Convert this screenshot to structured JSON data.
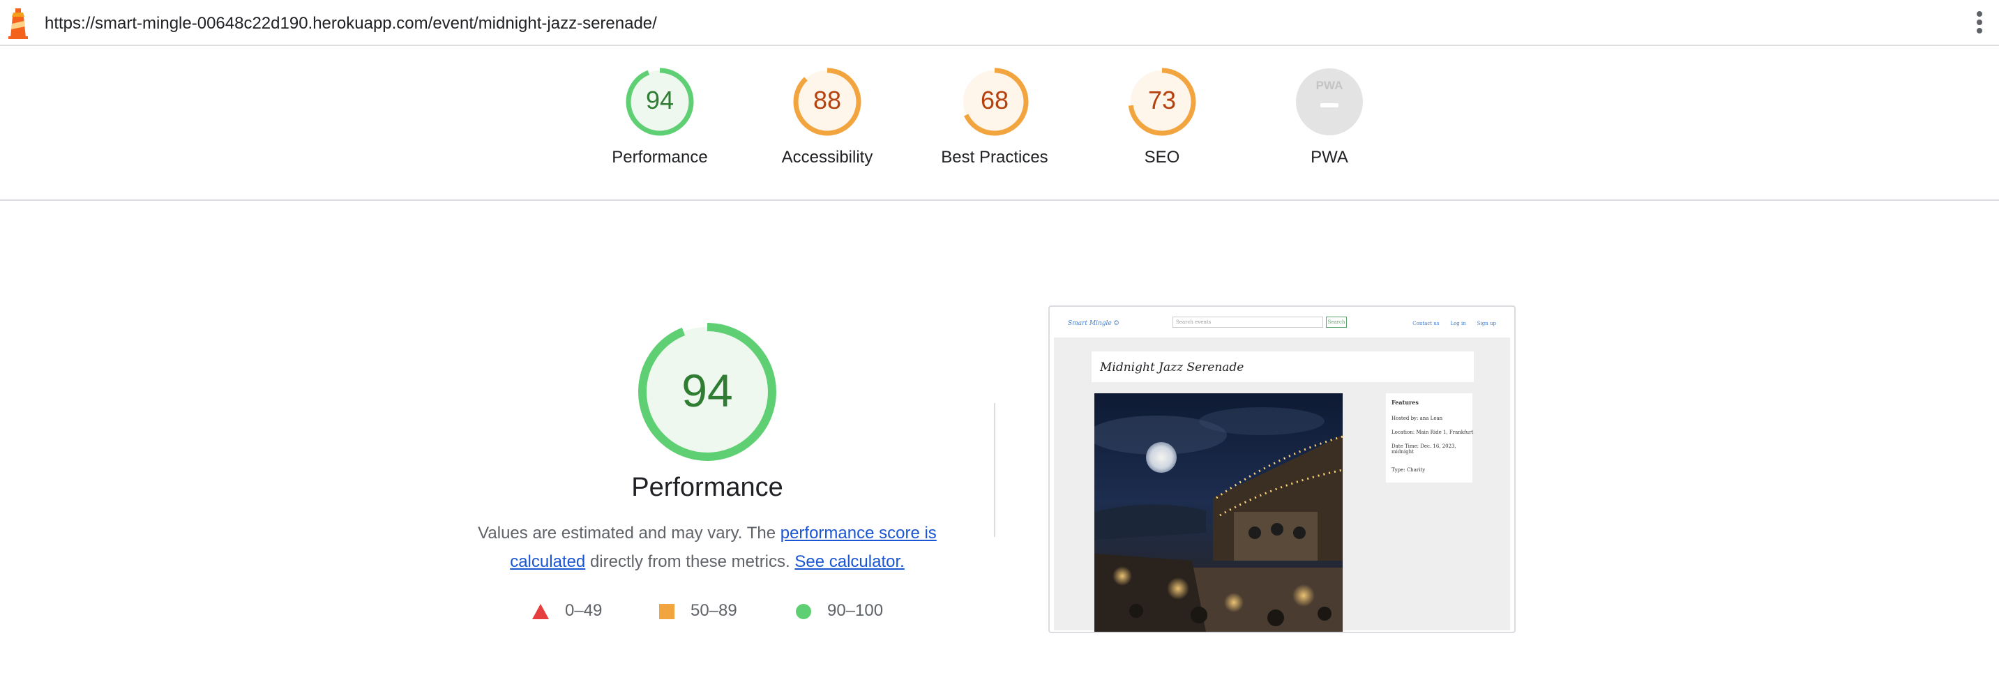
{
  "url": "https://smart-mingle-00648c22d190.herokuapp.com/event/midnight-jazz-serenade/",
  "colors": {
    "pass": "#0cce6b",
    "pass_ring": "#5fcf73",
    "pass_text": "#2e7d32",
    "pass_fill": "#eef8ee",
    "average": "#f2a43e",
    "average_text": "#b5410e",
    "average_fill": "#fef6ea",
    "fail": "#e63e3e",
    "na": "#e3e3e3",
    "link": "#1a55d4"
  },
  "categories": [
    {
      "label": "Performance",
      "score": "94",
      "value": 94,
      "rating": "pass"
    },
    {
      "label": "Accessibility",
      "score": "88",
      "value": 88,
      "rating": "average"
    },
    {
      "label": "Best Practices",
      "score": "68",
      "value": 68,
      "rating": "average"
    },
    {
      "label": "SEO",
      "score": "73",
      "value": 73,
      "rating": "average"
    },
    {
      "label": "PWA",
      "score": "",
      "value": null,
      "rating": "na",
      "badge": "PWA"
    }
  ],
  "detail": {
    "score": "94",
    "value": 94,
    "title": "Performance",
    "desc_prefix": "Values are estimated and may vary. The ",
    "desc_link1": "performance score is calculated",
    "desc_middle": " directly from these metrics. ",
    "desc_link2": "See calculator."
  },
  "legend": [
    {
      "range": "0–49",
      "icon": "triangle-icon",
      "color": "#e63e3e"
    },
    {
      "range": "50–89",
      "icon": "square-icon",
      "color": "#f2a43e"
    },
    {
      "range": "90–100",
      "icon": "circle-icon",
      "color": "#5fcf73"
    }
  ],
  "screenshot": {
    "brand": "Smart Mingle ☺",
    "search_placeholder": "Search events",
    "search_button": "Search",
    "nav_links": [
      "Contact us",
      "Log in",
      "Sign up"
    ],
    "event_title": "Midnight Jazz Serenade",
    "features_title": "Features",
    "features": [
      "Hosted by: ana Lean",
      "Location: Main Ride 1, Frankfurt",
      "Date Time: Dec. 16, 2023, midnight",
      "Type: Charity"
    ]
  }
}
